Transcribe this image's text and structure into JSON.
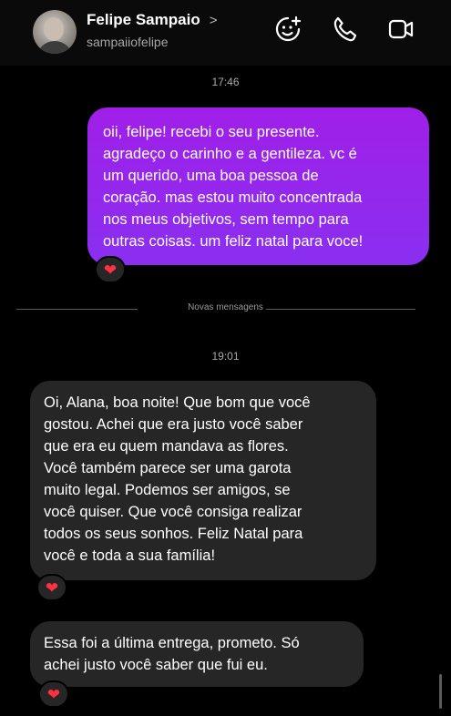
{
  "header": {
    "name": "Felipe Sampaio",
    "chevron": ">",
    "username": "sampaiiofelipe",
    "icons": [
      "video-effects-icon",
      "phone-icon",
      "video-camera-icon"
    ]
  },
  "messages": {
    "time1": "17:46",
    "outgoing": "oii, felipe! recebi o seu presente.\nagradeço o carinho e a gentileza. vc é\num querido, uma boa pessoa de\ncoração. mas estou muito concentrada\nnos meus objetivos, sem tempo para\noutras coisas. um feliz natal para voce!",
    "divider": "Novas mensagens",
    "time2": "19:01",
    "incoming1": "Oi, Alana, boa noite! Que bom que você\ngostou. Achei que era justo você saber\nque era eu quem mandava as flores.\nVocê também parece ser uma garota\nmuito legal. Podemos ser amigos, se\nvocê quiser. Que você consiga realizar\ntodos os seus sonhos. Feliz Natal para\nvocê e toda a sua família!",
    "incoming2": "Essa foi a última entrega, prometo. Só\nachei justo você saber que fui eu.",
    "reaction": "❤"
  },
  "colors": {
    "background": "#000000",
    "outgoing_bubble": "#9b24ea",
    "incoming_bubble": "#262626",
    "reaction_heart": "#ff3040"
  }
}
